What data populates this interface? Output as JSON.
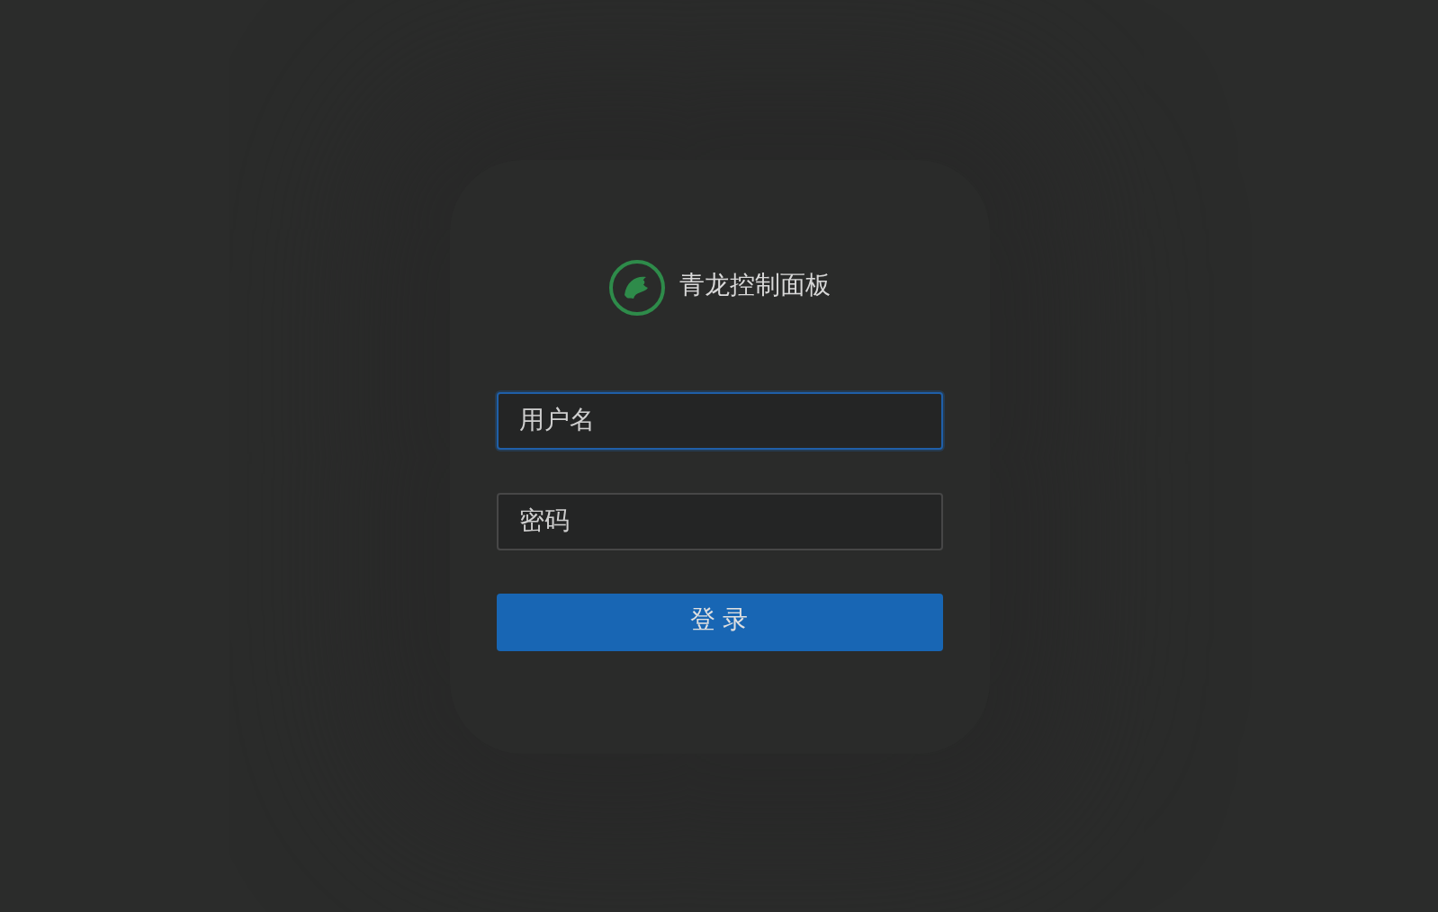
{
  "title": "青龙控制面板",
  "fields": [
    {
      "placeholder": "用户名",
      "focused": true
    },
    {
      "placeholder": "密码",
      "focused": false
    }
  ],
  "button": "登 录"
}
